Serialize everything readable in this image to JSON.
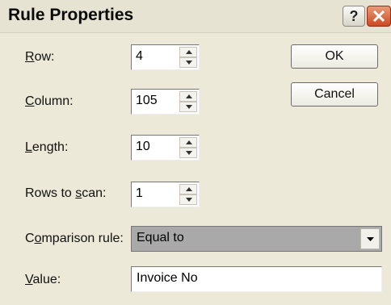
{
  "window": {
    "title": "Rule Properties",
    "help_glyph": "?"
  },
  "fields": {
    "row": {
      "label_prefix": "",
      "label_key": "R",
      "label_rest": "ow:",
      "value": "4"
    },
    "column": {
      "label_prefix": "",
      "label_key": "C",
      "label_rest": "olumn:",
      "value": "105"
    },
    "length": {
      "label_prefix": "",
      "label_key": "L",
      "label_rest": "ength:",
      "value": "10"
    },
    "rows_to_scan": {
      "label_prefix": "Rows to ",
      "label_key": "s",
      "label_rest": "can:",
      "value": "1"
    },
    "comparison_rule": {
      "label_prefix": "C",
      "label_key": "o",
      "label_rest": "mparison rule:",
      "value": "Equal to"
    },
    "value": {
      "label_prefix": "",
      "label_key": "V",
      "label_rest": "alue:",
      "value": "Invoice No"
    }
  },
  "buttons": {
    "ok": "OK",
    "cancel": "Cancel"
  },
  "colors": {
    "dialog_bg": "#ece9d8",
    "combo_bg": "#a9a9a9",
    "close_red": "#cc4a22"
  }
}
